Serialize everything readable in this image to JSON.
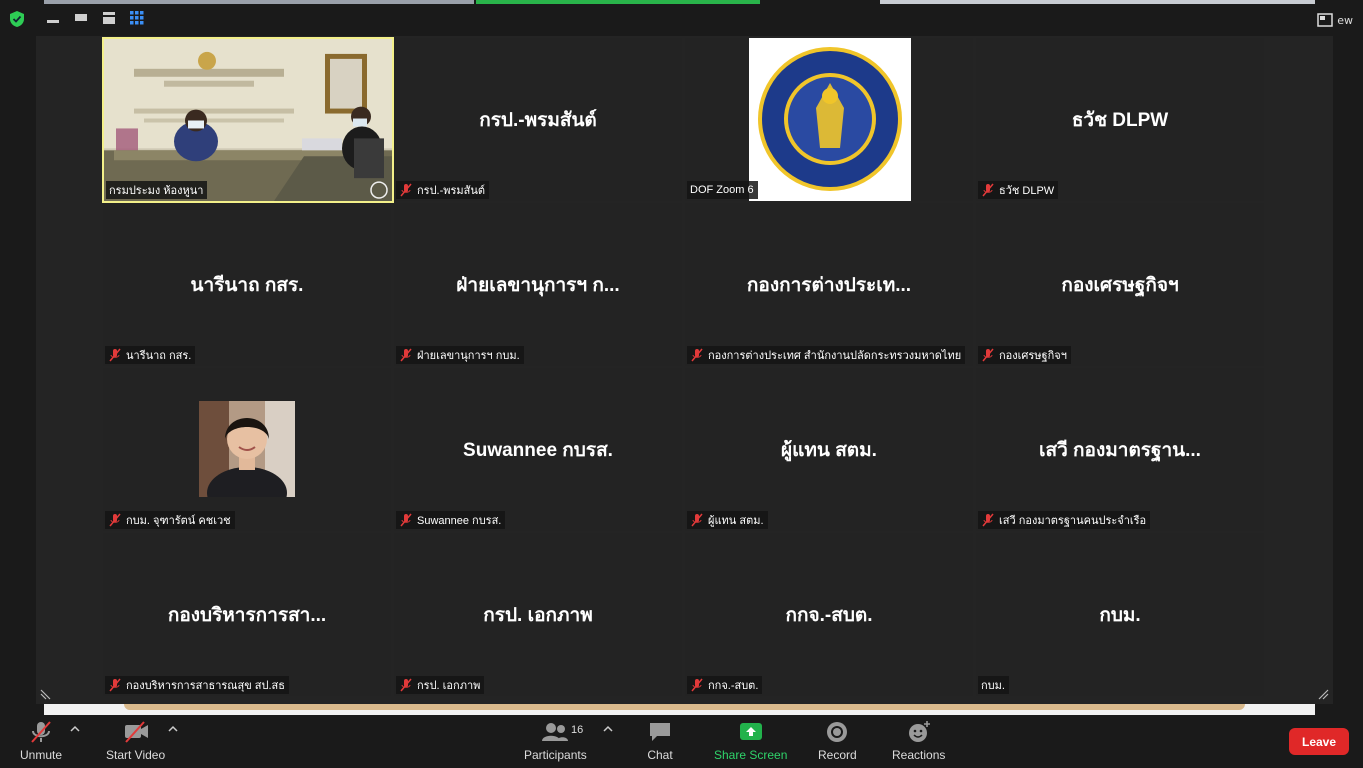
{
  "window": {
    "view_label": "ew"
  },
  "colors": {
    "active_speaker_border": "#f3f08a",
    "share_strip": "#29b34a",
    "leave_button": "#e02828",
    "share_screen_icon": "#22b24c",
    "share_screen_label": "#2fd36a",
    "muted_icon": "#e23a3a"
  },
  "icons": {
    "security": "shield-check-icon",
    "view_minimize": "minimize-icon",
    "view_strip": "strip-view-icon",
    "view_speaker": "speaker-view-icon",
    "view_gallery": "gallery-view-icon",
    "view_menu": "view-options-icon",
    "muted": "muted-mic-icon"
  },
  "tiles": [
    {
      "display": "",
      "nametag": "กรมประมง ห้องหูนา",
      "muted": false,
      "media": "video"
    },
    {
      "display": "กรป.-พรมสันต์",
      "nametag": "กรป.-พรมสันต์",
      "muted": true
    },
    {
      "display": "",
      "nametag": "DOF Zoom 6",
      "muted": false,
      "media": "logo"
    },
    {
      "display": "ธวัช DLPW",
      "nametag": "ธวัช DLPW",
      "muted": true
    },
    {
      "display": "นารีนาถ กสร.",
      "nametag": "นารีนาถ กสร.",
      "muted": true
    },
    {
      "display": "ฝ่ายเลขานุการฯ ก...",
      "nametag": "ฝ่ายเลขานุการฯ กบม.",
      "muted": true
    },
    {
      "display": "กองการต่างประเท...",
      "nametag": "กองการต่างประเทศ สำนักงานปลัดกระทรวงมหาดไทย",
      "muted": true
    },
    {
      "display": "กองเศรษฐกิจฯ",
      "nametag": "กองเศรษฐกิจฯ",
      "muted": true
    },
    {
      "display": "",
      "nametag": "กบม. จุฑารัตน์ คชเวช",
      "muted": true,
      "media": "photo"
    },
    {
      "display": "Suwannee กบรส.",
      "nametag": "Suwannee กบรส.",
      "muted": true
    },
    {
      "display": "ผู้แทน สตม.",
      "nametag": "ผู้แทน สตม.",
      "muted": true
    },
    {
      "display": "เสวี กองมาตรฐาน...",
      "nametag": "เสวี กองมาตรฐานคนประจำเรือ",
      "muted": true
    },
    {
      "display": "กองบริหารการสา...",
      "nametag": "กองบริหารการสาธารณสุข สป.สธ",
      "muted": true
    },
    {
      "display": "กรป. เอกภาพ",
      "nametag": "กรป. เอกภาพ",
      "muted": true
    },
    {
      "display": "กกจ.-สบต.",
      "nametag": "กกจ.-สบต.",
      "muted": true
    },
    {
      "display": "กบม.",
      "nametag": "กบม.",
      "muted": false
    }
  ],
  "toolbar": {
    "unmute": "Unmute",
    "start_video": "Start Video",
    "participants": "Participants",
    "participants_count": "16",
    "chat": "Chat",
    "share_screen": "Share Screen",
    "record": "Record",
    "reactions": "Reactions",
    "leave": "Leave"
  }
}
